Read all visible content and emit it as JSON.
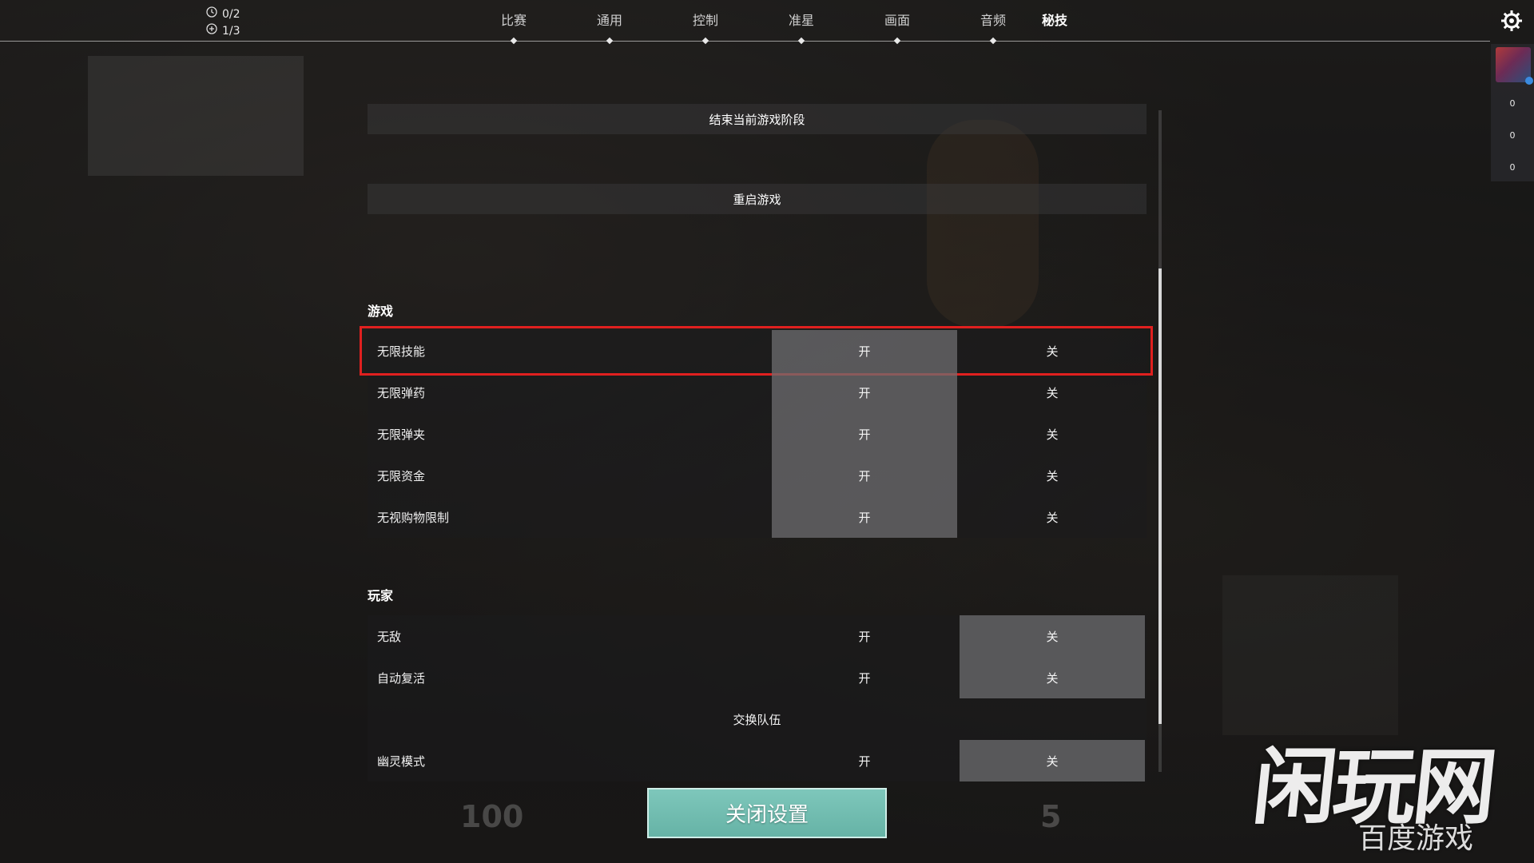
{
  "top": {
    "counters": [
      {
        "icon": "clock-icon",
        "value": "0/2"
      },
      {
        "icon": "plus-circle-icon",
        "value": "1/3"
      }
    ],
    "tabs": [
      "比赛",
      "通用",
      "控制",
      "准星",
      "画面",
      "音频",
      "秘技"
    ],
    "active_tab": "秘技",
    "settings_icon": "gear-icon"
  },
  "sidebar": {
    "scores": [
      "0",
      "0",
      "0"
    ]
  },
  "actions": {
    "end_phase": "结束当前游戏阶段",
    "restart": "重启游戏"
  },
  "game_section": {
    "title": "游戏",
    "rows": [
      {
        "label": "无限技能",
        "on": "开",
        "off": "关",
        "selected": "on"
      },
      {
        "label": "无限弹药",
        "on": "开",
        "off": "关",
        "selected": "on"
      },
      {
        "label": "无限弹夹",
        "on": "开",
        "off": "关",
        "selected": "on"
      },
      {
        "label": "无限资金",
        "on": "开",
        "off": "关",
        "selected": "on"
      },
      {
        "label": "无视购物限制",
        "on": "开",
        "off": "关",
        "selected": "on"
      }
    ]
  },
  "player_section": {
    "title": "玩家",
    "rows": [
      {
        "label": "无敌",
        "on": "开",
        "off": "关",
        "selected": "off"
      },
      {
        "label": "自动复活",
        "on": "开",
        "off": "关",
        "selected": "off"
      }
    ],
    "swap_team": "交换队伍",
    "ghost": {
      "label": "幽灵模式",
      "on": "开",
      "off": "关",
      "selected": "off"
    }
  },
  "close_button": "关闭设置",
  "hud": {
    "health": "100",
    "ammo": "5"
  },
  "watermark": {
    "main": "闲玩网",
    "sub": "百度游戏"
  },
  "colors": {
    "accent_button": "#70bcb0",
    "highlight_border": "#e0201f"
  }
}
